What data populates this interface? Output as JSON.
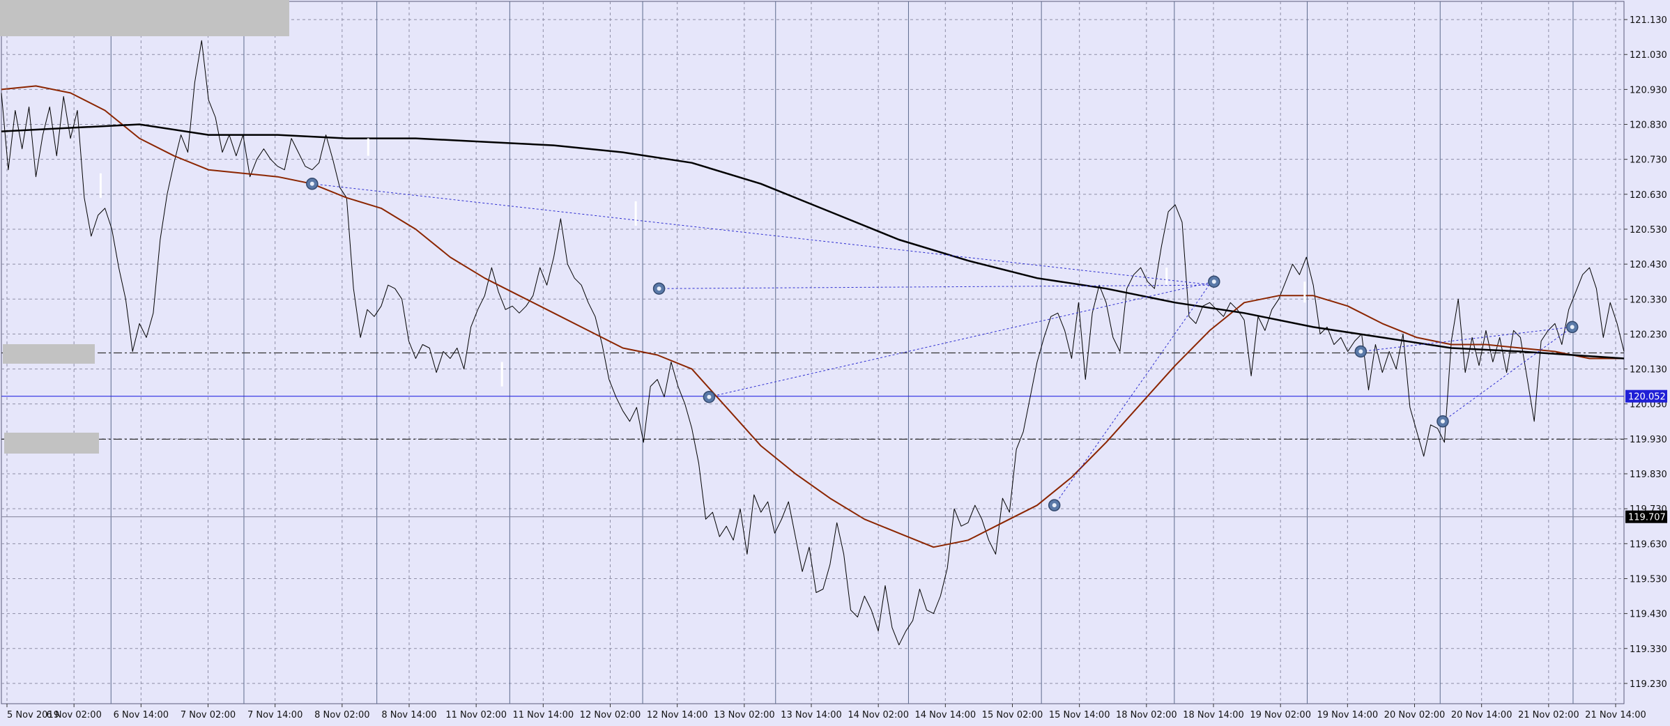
{
  "chart_data": {
    "type": "line",
    "price_ticks": [
      "121.130",
      "121.030",
      "120.930",
      "120.830",
      "120.730",
      "120.630",
      "120.530",
      "120.430",
      "120.330",
      "120.230",
      "120.130",
      "120.030",
      "119.930",
      "119.830",
      "119.730",
      "119.630",
      "119.530",
      "119.430",
      "119.330",
      "119.230"
    ],
    "time_ticks": [
      "5 Nov 2019",
      "6 Nov 02:00",
      "6 Nov 14:00",
      "7 Nov 02:00",
      "7 Nov 14:00",
      "8 Nov 02:00",
      "8 Nov 14:00",
      "11 Nov 02:00",
      "11 Nov 14:00",
      "12 Nov 02:00",
      "12 Nov 14:00",
      "13 Nov 02:00",
      "13 Nov 14:00",
      "14 Nov 02:00",
      "14 Nov 14:00",
      "15 Nov 02:00",
      "15 Nov 14:00",
      "18 Nov 02:00",
      "18 Nov 14:00",
      "19 Nov 02:00",
      "19 Nov 14:00",
      "20 Nov 02:00",
      "20 Nov 14:00",
      "21 Nov 02:00",
      "21 Nov 14:00"
    ],
    "ylim": [
      119.172,
      121.182
    ],
    "grid": true,
    "price_labels": [
      {
        "text": "120.052",
        "value": 120.052,
        "bg": "#1f1fd6",
        "fg": "#ffffff"
      },
      {
        "text": "119.707",
        "value": 119.707,
        "bg": "#000000",
        "fg": "#ffffff"
      }
    ],
    "hlines": [
      {
        "value": 120.052,
        "style": "solid",
        "color": "#2a2ae0"
      },
      {
        "value": 119.707,
        "style": "solid",
        "color": "#8a8aa0"
      },
      {
        "value": 120.176,
        "style": "dashdot",
        "color": "#333333"
      },
      {
        "value": 119.929,
        "style": "dashdot",
        "color": "#333333"
      }
    ],
    "series": [
      {
        "color": "#000000",
        "width": 1,
        "x": [
          0,
          0.8,
          1.6,
          2.4,
          3.2,
          4,
          4.8,
          5.6,
          6.4,
          7.2,
          8,
          8.8,
          9.6,
          10.4,
          11.2,
          12,
          12.8,
          13.6,
          14.4,
          15.2,
          16,
          16.8,
          17.6,
          18.4,
          19.2,
          20,
          20.8,
          21.6,
          22.4,
          23.2,
          24
        ],
        "y": [
          120.92,
          120.7,
          120.87,
          120.76,
          120.88,
          120.68,
          120.8,
          120.88,
          120.74,
          120.91,
          120.79,
          120.87,
          120.62,
          120.51,
          120.57,
          120.59,
          120.53,
          120.42,
          120.33,
          120.18,
          120.26,
          120.22,
          120.29,
          120.5,
          120.63,
          120.72,
          120.8,
          120.75,
          120.95,
          121.07,
          120.9
        ],
        "x2": [
          24,
          24.8,
          25.6,
          26.4,
          27.2,
          28,
          28.8,
          29.6,
          30.4,
          31.2,
          32,
          32.8,
          33.6,
          34.4,
          35.2,
          36,
          36.8,
          37.6,
          38.4,
          39.2,
          40,
          40.8,
          41.6,
          42.4,
          43.2,
          44,
          44.8,
          45.6,
          46.4,
          47.2,
          48
        ],
        "y2": [
          120.9,
          120.85,
          120.75,
          120.8,
          120.74,
          120.8,
          120.68,
          120.73,
          120.76,
          120.73,
          120.71,
          120.7,
          120.79,
          120.75,
          120.71,
          120.7,
          120.72,
          120.8,
          120.73,
          120.65,
          120.62,
          120.36,
          120.22,
          120.3,
          120.28,
          120.31,
          120.37,
          120.36,
          120.33,
          120.21,
          120.16
        ],
        "x3": [
          48,
          48.8,
          49.6,
          50.4,
          51.2,
          52,
          52.8,
          53.6,
          54.4,
          55.2,
          56,
          56.8,
          57.6,
          58.4,
          59.2,
          60,
          60.8,
          61.6,
          62.4,
          63.2,
          64,
          64.8,
          65.6,
          66.4,
          67.2,
          68,
          68.8,
          69.6,
          70.4,
          71.2,
          72
        ],
        "y3": [
          120.16,
          120.2,
          120.19,
          120.12,
          120.18,
          120.16,
          120.19,
          120.13,
          120.25,
          120.3,
          120.34,
          120.42,
          120.35,
          120.3,
          120.31,
          120.29,
          120.31,
          120.34,
          120.42,
          120.37,
          120.45,
          120.56,
          120.43,
          120.39,
          120.37,
          120.32,
          120.28,
          120.2,
          120.1,
          120.05,
          120.01
        ],
        "x4": [
          72,
          72.8,
          73.6,
          74.4,
          75.2,
          76,
          76.8,
          77.6,
          78.4,
          79.2,
          80,
          80.8,
          81.6,
          82.4,
          83.2,
          84,
          84.8,
          85.6,
          86.4,
          87.2,
          88,
          88.8,
          89.6,
          90.4,
          91.2,
          92,
          92.8,
          93.6,
          94.4,
          95.2,
          96
        ],
        "y4": [
          120.01,
          119.98,
          120.02,
          119.92,
          120.08,
          120.1,
          120.05,
          120.15,
          120.08,
          120.03,
          119.96,
          119.86,
          119.7,
          119.72,
          119.65,
          119.68,
          119.64,
          119.73,
          119.6,
          119.77,
          119.72,
          119.75,
          119.66,
          119.7,
          119.75,
          119.65,
          119.55,
          119.62,
          119.49,
          119.5,
          119.57
        ],
        "x5": [
          96,
          96.8,
          97.6,
          98.4,
          99.2,
          100,
          100.8,
          101.6,
          102.4,
          103.2,
          104,
          104.8,
          105.6,
          106.4,
          107.2,
          108,
          108.8,
          109.6,
          110.4,
          111.2,
          112,
          112.8,
          113.6,
          114.4,
          115.2,
          116,
          116.8,
          117.6,
          118.4,
          119.2,
          120
        ],
        "y5": [
          119.57,
          119.69,
          119.6,
          119.44,
          119.42,
          119.48,
          119.44,
          119.38,
          119.51,
          119.39,
          119.34,
          119.38,
          119.41,
          119.5,
          119.44,
          119.43,
          119.48,
          119.56,
          119.73,
          119.68,
          119.69,
          119.74,
          119.7,
          119.64,
          119.6,
          119.76,
          119.72,
          119.9,
          119.95,
          120.05,
          120.15
        ],
        "x6": [
          120,
          120.8,
          121.6,
          122.4,
          123.2,
          124,
          124.8,
          125.6,
          126.4,
          127.2,
          128,
          128.8,
          129.6,
          130.4,
          131.2,
          132,
          132.8,
          133.6,
          134.4,
          135.2,
          136,
          136.8,
          137.6,
          138.4,
          139.2,
          140,
          140.8,
          141.6,
          142.4,
          143.2,
          144
        ],
        "y6": [
          120.15,
          120.22,
          120.28,
          120.29,
          120.24,
          120.16,
          120.32,
          120.1,
          120.29,
          120.37,
          120.32,
          120.22,
          120.18,
          120.36,
          120.4,
          120.42,
          120.38,
          120.36,
          120.48,
          120.58,
          120.6,
          120.55,
          120.28,
          120.26,
          120.31,
          120.32,
          120.3,
          120.28,
          120.32,
          120.3,
          120.27
        ],
        "x7": [
          144,
          144.8,
          145.6,
          146.4,
          147.2,
          148,
          148.8,
          149.6,
          150.4,
          151.2,
          152,
          152.8,
          153.6,
          154.4,
          155.2,
          156,
          156.8,
          157.6,
          158.4,
          159.2,
          160,
          160.8,
          161.6,
          162.4,
          163.2,
          164,
          164.8,
          165.6,
          166.4,
          167.2,
          168
        ],
        "y7": [
          120.27,
          120.11,
          120.28,
          120.24,
          120.3,
          120.33,
          120.38,
          120.43,
          120.4,
          120.45,
          120.37,
          120.23,
          120.25,
          120.2,
          120.22,
          120.18,
          120.21,
          120.23,
          120.07,
          120.2,
          120.12,
          120.18,
          120.13,
          120.23,
          120.02,
          119.95,
          119.88,
          119.97,
          119.96,
          119.92,
          120.21
        ],
        "x8": [
          168,
          168.8,
          169.6,
          170.4,
          171.2,
          172,
          172.8,
          173.6,
          174.4,
          175.2,
          176,
          176.8,
          177.6,
          178.4,
          179.2,
          180,
          180.8,
          181.6,
          182.4,
          183.2,
          184,
          184.8,
          185.6,
          186.4,
          187.2,
          188
        ],
        "y8": [
          120.21,
          120.33,
          120.12,
          120.22,
          120.14,
          120.24,
          120.15,
          120.22,
          120.12,
          120.24,
          120.22,
          120.1,
          119.98,
          120.21,
          120.24,
          120.26,
          120.2,
          120.3,
          120.35,
          120.4,
          120.42,
          120.36,
          120.22,
          120.32,
          120.26,
          120.18
        ]
      },
      {
        "color": "#8b2500",
        "width": 2,
        "x": [
          0,
          4,
          8,
          12,
          16,
          20,
          24,
          28,
          32,
          36,
          40,
          44,
          48,
          52,
          56,
          60,
          64,
          68,
          72,
          76,
          80,
          84,
          88,
          92,
          96,
          100,
          104,
          108,
          112,
          116,
          120,
          124,
          128,
          132,
          136,
          140,
          144,
          148,
          152,
          156,
          160,
          164,
          168,
          172,
          176,
          180,
          184,
          188
        ],
        "y": [
          120.93,
          120.94,
          120.92,
          120.87,
          120.79,
          120.74,
          120.7,
          120.69,
          120.68,
          120.66,
          120.62,
          120.59,
          120.53,
          120.45,
          120.39,
          120.34,
          120.29,
          120.24,
          120.19,
          120.17,
          120.13,
          120.02,
          119.91,
          119.83,
          119.76,
          119.7,
          119.66,
          119.62,
          119.64,
          119.69,
          119.74,
          119.82,
          119.92,
          120.03,
          120.14,
          120.24,
          120.32,
          120.34,
          120.34,
          120.31,
          120.26,
          120.22,
          120.2,
          120.2,
          120.19,
          120.18,
          120.16,
          120.16
        ]
      },
      {
        "color": "#000000",
        "width": 2.5,
        "x": [
          0,
          8,
          16,
          24,
          32,
          40,
          48,
          56,
          64,
          72,
          80,
          88,
          96,
          104,
          112,
          120,
          128,
          136,
          144,
          152,
          160,
          168,
          176,
          182,
          188
        ],
        "y": [
          120.81,
          120.82,
          120.83,
          120.8,
          120.8,
          120.79,
          120.79,
          120.78,
          120.77,
          120.75,
          120.72,
          120.66,
          120.58,
          120.5,
          120.44,
          120.39,
          120.36,
          120.32,
          120.29,
          120.25,
          120.22,
          120.19,
          120.18,
          120.17,
          120.16
        ]
      }
    ],
    "trendlines": [
      {
        "x1": 36,
        "y1": 120.66,
        "x2": 140.5,
        "y2": 120.37
      },
      {
        "x1": 76.2,
        "y1": 120.36,
        "x2": 140.5,
        "y2": 120.37
      },
      {
        "x1": 82,
        "y1": 120.05,
        "x2": 140.5,
        "y2": 120.38
      },
      {
        "x1": 122,
        "y1": 119.74,
        "x2": 140.5,
        "y2": 120.39
      },
      {
        "x1": 157.5,
        "y1": 120.18,
        "x2": 182,
        "y2": 120.25
      },
      {
        "x1": 167,
        "y1": 119.98,
        "x2": 182,
        "y2": 120.25
      }
    ],
    "markers": [
      {
        "x": 36,
        "y": 120.66
      },
      {
        "x": 76.2,
        "y": 120.36
      },
      {
        "x": 82,
        "y": 120.05
      },
      {
        "x": 122,
        "y": 119.74
      },
      {
        "x": 140.5,
        "y": 120.38
      },
      {
        "x": 157.5,
        "y": 120.18
      },
      {
        "x": 167,
        "y": 119.98
      },
      {
        "x": 182,
        "y": 120.25
      }
    ],
    "ticks_marks": [
      {
        "x": 11.5,
        "y1": 120.69,
        "y2": 120.62
      },
      {
        "x": 42.5,
        "y1": 120.79,
        "y2": 120.74
      },
      {
        "x": 58,
        "y1": 120.15,
        "y2": 120.08
      },
      {
        "x": 73.5,
        "y1": 120.61,
        "y2": 120.54
      },
      {
        "x": 135,
        "y1": 120.42,
        "y2": 120.37
      },
      {
        "x": 151,
        "y1": 120.38,
        "y2": 120.32
      }
    ]
  }
}
